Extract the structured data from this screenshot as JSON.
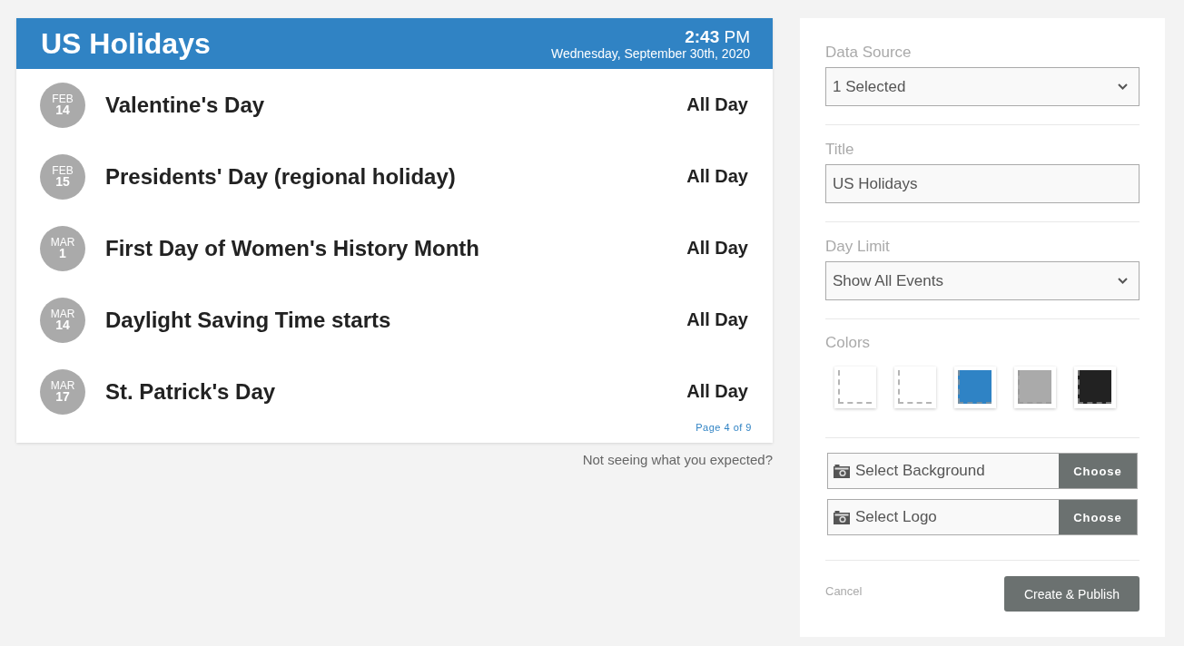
{
  "card": {
    "title": "US Holidays",
    "time": "**2:43** PM",
    "date": "Wednesday, September 30th, 2020",
    "events": [
      {
        "month": "FEB",
        "day": "14",
        "name": "Valentine's Day",
        "time": "All Day"
      },
      {
        "month": "FEB",
        "day": "15",
        "name": "Presidents' Day (regional holiday)",
        "time": "All Day"
      },
      {
        "month": "MAR",
        "day": "1",
        "name": "First Day of Women's History Month",
        "time": "All Day"
      },
      {
        "month": "MAR",
        "day": "14",
        "name": "Daylight Saving Time starts",
        "time": "All Day"
      },
      {
        "month": "MAR",
        "day": "17",
        "name": "St. Patrick's Day",
        "time": "All Day"
      }
    ],
    "pagination": "Page 4 of 9"
  },
  "help_link": "Not seeing what you expected?",
  "settings": {
    "fields": [
      {
        "kind": "select",
        "label": "Data Source",
        "value": "1 Selected"
      },
      {
        "kind": "input",
        "label": "Title",
        "value": "US Holidays"
      },
      {
        "kind": "select",
        "label": "Day Limit",
        "value": "Show All Events"
      }
    ],
    "colors": {
      "label": "Colors",
      "swatches": [
        {
          "color": "#ffffff"
        },
        {
          "color": "#ffffff"
        },
        {
          "color": "#2f83c5"
        },
        {
          "color": "#aaaaaa"
        },
        {
          "color": "#222222"
        }
      ]
    },
    "uploads": [
      {
        "label": "Select Background",
        "button": "Choose"
      },
      {
        "label": "Select Logo",
        "button": "Choose"
      }
    ],
    "cancel": "Cancel",
    "submit": "Create & Publish"
  }
}
